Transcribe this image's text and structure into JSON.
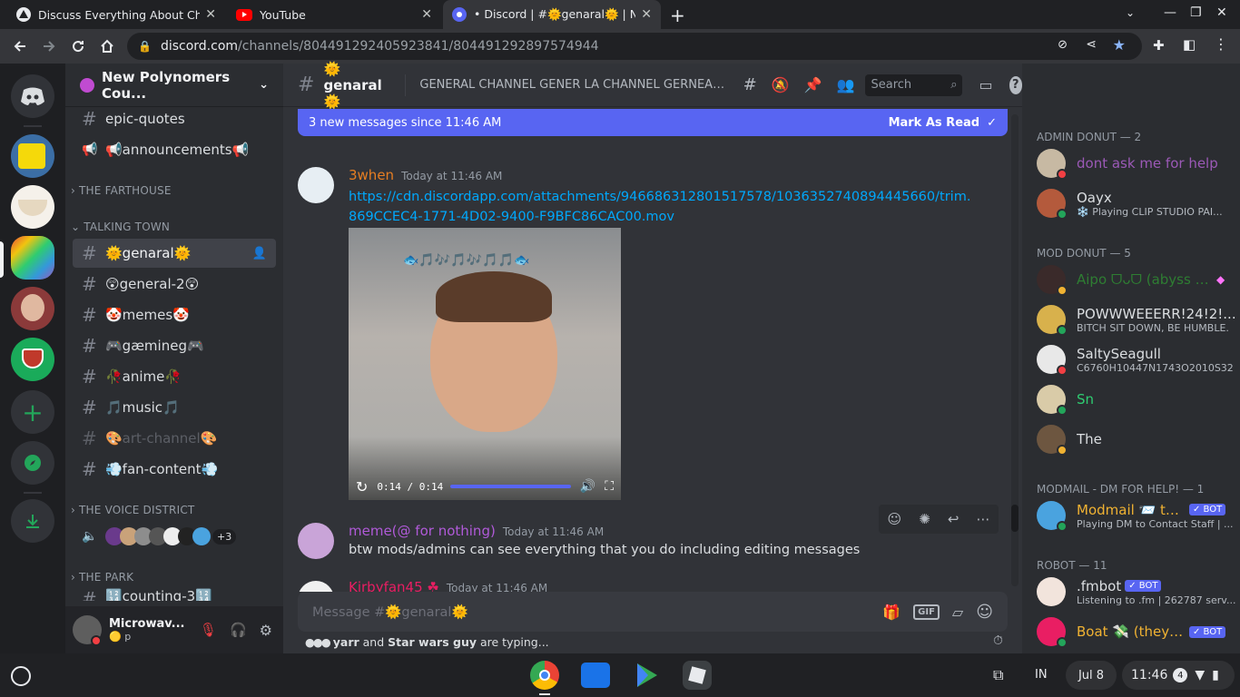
{
  "browser": {
    "tabs": [
      {
        "title": "Discuss Everything About Chang",
        "icon": "site-icon"
      },
      {
        "title": "YouTube",
        "icon": "youtube-icon"
      },
      {
        "title": "• Discord | #🌞genaral🌞 | New P",
        "icon": "discord-icon"
      }
    ],
    "url_domain": "discord.com",
    "url_path": "/channels/804491292405923841/804491292897574944"
  },
  "server": {
    "name": "New Polynomers Cou..."
  },
  "channels": {
    "top": [
      {
        "name": "epic-quotes"
      },
      {
        "name": "📢announcements📢"
      }
    ],
    "categories": [
      "THE FARTHOUSE",
      "TALKING TOWN",
      "THE VOICE DISTRICT",
      "THE PARK"
    ],
    "talking_town": [
      {
        "name": "🌞genaral🌞"
      },
      {
        "name": "😲general-2😲"
      },
      {
        "name": "🤡memes🤡"
      },
      {
        "name": "🎮gæmineg🎮"
      },
      {
        "name": "🥀anime🥀"
      },
      {
        "name": "🎵music🎵"
      },
      {
        "name": "🎨art-channel🎨"
      },
      {
        "name": "💨fan-content💨"
      }
    ],
    "voice_more": "+3",
    "park_first": "🔢counting-3🔢"
  },
  "user": {
    "name": "Microwav...",
    "status": "p"
  },
  "channel_header": {
    "name": "🌞genaral🌞",
    "topic": "GENERAL CHANNEL GENER LA CHANNEL GERNEAL TALK ABUOT GENAR...",
    "search_placeholder": "Search"
  },
  "new_messages_bar": {
    "text": "3 new messages since 11:46 AM",
    "action": "Mark As Read"
  },
  "messages": [
    {
      "author": "3when",
      "timestamp": "Today at 11:46 AM",
      "link": "https://cdn.discordapp.com/attachments/946686312801517578/1036352740894445660/trim.869CCEC4-1771-4D02-9400-F9BFC86CAC00.mov",
      "video_time": "0:14 / 0:14",
      "video_progress": 1.0,
      "video_caption": "🐟🎵🎶🎵🎶🎵🎵🐟"
    },
    {
      "author": "meme(@ for nothing)",
      "timestamp": "Today at 11:46 AM",
      "text": "btw mods/admins can see everything that you do including editing messages"
    },
    {
      "author": "Kirbyfan45 ☘",
      "timestamp": "Today at 11:46 AM"
    }
  ],
  "composer": {
    "placeholder": "Message #🌞genaral🌞",
    "typing": [
      {
        "name": "yarr"
      },
      {
        "text": " and "
      },
      {
        "name": "Star wars guy"
      },
      {
        "text": " are typing..."
      }
    ]
  },
  "members": {
    "categories": [
      "ADMIN DONUT — 2",
      "MOD DONUT — 5",
      "MODMAIL - DM FOR HELP! — 1",
      "ROBOT — 11"
    ],
    "list": [
      {
        "name": "dont ask me for help",
        "sub": "",
        "color": "#9b59b6"
      },
      {
        "name": "Oayx",
        "sub": "❄️ Playing CLIP STUDIO PAI...",
        "color": "#dbdee1"
      },
      {
        "name": "Aipo ᗜᴗᗜ (abyss d...",
        "sub": "",
        "color": "#2e7d32"
      },
      {
        "name": "POWWWEEERR!24!2!...",
        "sub": "BITCH SIT DOWN, BE HUMBLE.",
        "color": "#dbdee1"
      },
      {
        "name": "SaltySeagull",
        "sub": "C6760H10447N1743O2010S32",
        "color": "#dbdee1"
      },
      {
        "name": "Sn",
        "sub": "",
        "color": "#2ecc71"
      },
      {
        "name": "The",
        "sub": "",
        "color": "#dbdee1"
      },
      {
        "name": "Modmail 📨 the...",
        "sub": "Playing DM to Contact Staff | ...",
        "color": "#f0b232",
        "bot": "✓ BOT"
      },
      {
        "name": ".fmbot",
        "sub": "Listening to .fm | 262787 serv...",
        "color": "#dbdee1",
        "bot": "✓ BOT"
      },
      {
        "name": "Boat 💸 (they/h...",
        "sub": "",
        "color": "#f0b232",
        "bot": "✓ BOT"
      }
    ]
  },
  "taskbar": {
    "lang": "IN",
    "date": "Jul 8",
    "time": "11:46",
    "notif_count": "4"
  }
}
